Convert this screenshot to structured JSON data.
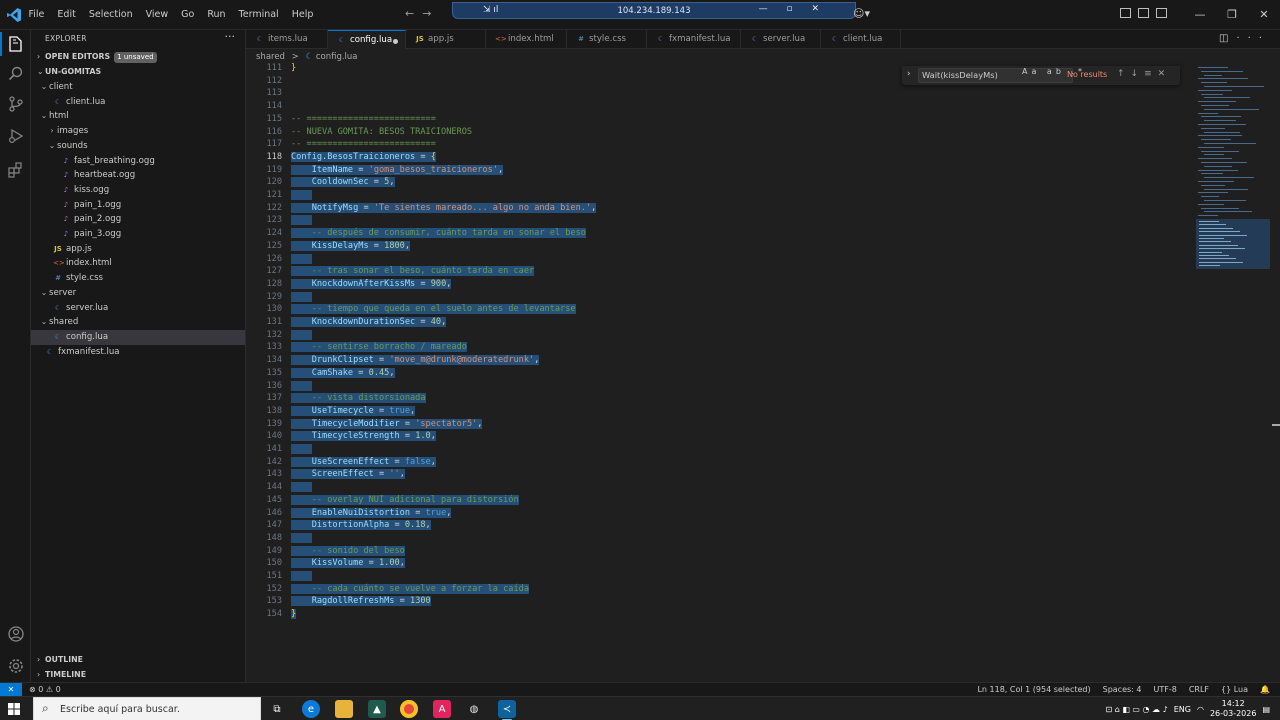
{
  "titlebar": {
    "menu": [
      "File",
      "Edit",
      "Selection",
      "View",
      "Go",
      "Run",
      "Terminal",
      "Help"
    ],
    "remote_ip": "104.234.189.143"
  },
  "sidebar": {
    "title": "EXPLORER",
    "open_editors_label": "OPEN EDITORS",
    "unsaved_badge": "1 unsaved",
    "project_label": "UN-GOMITAS",
    "tree": [
      {
        "label": "client",
        "type": "folder",
        "open": true,
        "depth": 1
      },
      {
        "label": "client.lua",
        "type": "lua",
        "depth": 2
      },
      {
        "label": "html",
        "type": "folder",
        "open": true,
        "depth": 1
      },
      {
        "label": "images",
        "type": "folder",
        "open": false,
        "depth": 2
      },
      {
        "label": "sounds",
        "type": "folder",
        "open": true,
        "depth": 2
      },
      {
        "label": "fast_breathing.ogg",
        "type": "ogg",
        "depth": 3
      },
      {
        "label": "heartbeat.ogg",
        "type": "ogg",
        "depth": 3
      },
      {
        "label": "kiss.ogg",
        "type": "ogg",
        "depth": 3
      },
      {
        "label": "pain_1.ogg",
        "type": "ogg",
        "depth": 3
      },
      {
        "label": "pain_2.ogg",
        "type": "ogg",
        "depth": 3
      },
      {
        "label": "pain_3.ogg",
        "type": "ogg",
        "depth": 3
      },
      {
        "label": "app.js",
        "type": "js",
        "depth": 2
      },
      {
        "label": "index.html",
        "type": "html",
        "depth": 2
      },
      {
        "label": "style.css",
        "type": "css",
        "depth": 2
      },
      {
        "label": "server",
        "type": "folder",
        "open": true,
        "depth": 1
      },
      {
        "label": "server.lua",
        "type": "lua",
        "depth": 2
      },
      {
        "label": "shared",
        "type": "folder",
        "open": true,
        "depth": 1
      },
      {
        "label": "config.lua",
        "type": "lua",
        "depth": 2,
        "selected": true
      },
      {
        "label": "fxmanifest.lua",
        "type": "lua",
        "depth": 1
      }
    ],
    "outline_label": "OUTLINE",
    "timeline_label": "TIMELINE"
  },
  "tabs": [
    {
      "label": "items.lua",
      "type": "lua"
    },
    {
      "label": "config.lua",
      "type": "lua",
      "active": true,
      "dirty": true
    },
    {
      "label": "app.js",
      "type": "js"
    },
    {
      "label": "index.html",
      "type": "html"
    },
    {
      "label": "style.css",
      "type": "css"
    },
    {
      "label": "fxmanifest.lua",
      "type": "lua"
    },
    {
      "label": "server.lua",
      "type": "lua"
    },
    {
      "label": "client.lua",
      "type": "lua"
    }
  ],
  "breadcrumb": {
    "folder": "shared",
    "sep": ">",
    "file": "config.lua"
  },
  "find": {
    "query": "Wait(kissDelayMs)",
    "options": "Aa ab .*",
    "result": "No results"
  },
  "editor": {
    "current_line": 118,
    "lines": [
      {
        "n": 111,
        "tokens": [
          [
            "}",
            "br"
          ]
        ]
      },
      {
        "n": 112,
        "tokens": []
      },
      {
        "n": 113,
        "tokens": []
      },
      {
        "n": 114,
        "tokens": []
      },
      {
        "n": 115,
        "tokens": [
          [
            "-- =========================",
            "cm"
          ]
        ]
      },
      {
        "n": 116,
        "tokens": [
          [
            "-- NUEVA GOMITA: BESOS TRAICIONEROS",
            "cm"
          ]
        ]
      },
      {
        "n": 117,
        "tokens": [
          [
            "-- =========================",
            "cm"
          ]
        ]
      },
      {
        "n": 118,
        "sel": true,
        "tokens": [
          [
            "Config",
            "id"
          ],
          [
            ".",
            "op"
          ],
          [
            "BesosTraicioneros",
            "id"
          ],
          [
            " = ",
            "op"
          ],
          [
            "{",
            "br"
          ]
        ]
      },
      {
        "n": 119,
        "sel": true,
        "tokens": [
          [
            "    ",
            ""
          ],
          [
            "ItemName",
            "id"
          ],
          [
            " = ",
            "op"
          ],
          [
            "'goma_besos_traicioneros'",
            "str"
          ],
          [
            ",",
            "op"
          ]
        ]
      },
      {
        "n": 120,
        "sel": true,
        "tokens": [
          [
            "    ",
            ""
          ],
          [
            "CooldownSec",
            "id"
          ],
          [
            " = ",
            "op"
          ],
          [
            "5",
            "num"
          ],
          [
            ",",
            "op"
          ]
        ]
      },
      {
        "n": 121,
        "sel": true,
        "tokens": [
          [
            "    ",
            ""
          ]
        ]
      },
      {
        "n": 122,
        "sel": true,
        "tokens": [
          [
            "    ",
            ""
          ],
          [
            "NotifyMsg",
            "id"
          ],
          [
            " = ",
            "op"
          ],
          [
            "'Te sientes mareado... algo no anda bien.'",
            "str"
          ],
          [
            ",",
            "op"
          ]
        ]
      },
      {
        "n": 123,
        "sel": true,
        "tokens": [
          [
            "    ",
            ""
          ]
        ]
      },
      {
        "n": 124,
        "sel": true,
        "tokens": [
          [
            "    ",
            ""
          ],
          [
            "-- después de consumir, cuánto tarda en sonar el beso",
            "cm"
          ]
        ]
      },
      {
        "n": 125,
        "sel": true,
        "tokens": [
          [
            "    ",
            ""
          ],
          [
            "KissDelayMs",
            "id"
          ],
          [
            " = ",
            "op"
          ],
          [
            "1800",
            "num"
          ],
          [
            ",",
            "op"
          ]
        ]
      },
      {
        "n": 126,
        "sel": true,
        "tokens": [
          [
            "    ",
            ""
          ]
        ]
      },
      {
        "n": 127,
        "sel": true,
        "tokens": [
          [
            "    ",
            ""
          ],
          [
            "-- tras sonar el beso, cuánto tarda en caer",
            "cm"
          ]
        ]
      },
      {
        "n": 128,
        "sel": true,
        "tokens": [
          [
            "    ",
            ""
          ],
          [
            "KnockdownAfterKissMs",
            "id"
          ],
          [
            " = ",
            "op"
          ],
          [
            "900",
            "num"
          ],
          [
            ",",
            "op"
          ]
        ]
      },
      {
        "n": 129,
        "sel": true,
        "tokens": [
          [
            "    ",
            ""
          ]
        ]
      },
      {
        "n": 130,
        "sel": true,
        "tokens": [
          [
            "    ",
            ""
          ],
          [
            "-- tiempo que queda en el suelo antes de levantarse",
            "cm"
          ]
        ]
      },
      {
        "n": 131,
        "sel": true,
        "tokens": [
          [
            "    ",
            ""
          ],
          [
            "KnockdownDurationSec",
            "id"
          ],
          [
            " = ",
            "op"
          ],
          [
            "40",
            "num"
          ],
          [
            ",",
            "op"
          ]
        ]
      },
      {
        "n": 132,
        "sel": true,
        "tokens": [
          [
            "    ",
            ""
          ]
        ]
      },
      {
        "n": 133,
        "sel": true,
        "tokens": [
          [
            "    ",
            ""
          ],
          [
            "-- sentirse borracho / mareado",
            "cm"
          ]
        ]
      },
      {
        "n": 134,
        "sel": true,
        "tokens": [
          [
            "    ",
            ""
          ],
          [
            "DrunkClipset",
            "id"
          ],
          [
            " = ",
            "op"
          ],
          [
            "'move_m@drunk@moderatedrunk'",
            "str"
          ],
          [
            ",",
            "op"
          ]
        ]
      },
      {
        "n": 135,
        "sel": true,
        "tokens": [
          [
            "    ",
            ""
          ],
          [
            "CamShake",
            "id"
          ],
          [
            " = ",
            "op"
          ],
          [
            "0.45",
            "num"
          ],
          [
            ",",
            "op"
          ]
        ]
      },
      {
        "n": 136,
        "sel": true,
        "tokens": [
          [
            "    ",
            ""
          ]
        ]
      },
      {
        "n": 137,
        "sel": true,
        "tokens": [
          [
            "    ",
            ""
          ],
          [
            "-- vista distorsionada",
            "cm"
          ]
        ]
      },
      {
        "n": 138,
        "sel": true,
        "tokens": [
          [
            "    ",
            ""
          ],
          [
            "UseTimecycle",
            "id"
          ],
          [
            " = ",
            "op"
          ],
          [
            "true",
            "kw"
          ],
          [
            ",",
            "op"
          ]
        ]
      },
      {
        "n": 139,
        "sel": true,
        "tokens": [
          [
            "    ",
            ""
          ],
          [
            "TimecycleModifier",
            "id"
          ],
          [
            " = ",
            "op"
          ],
          [
            "'spectator5'",
            "str"
          ],
          [
            ",",
            "op"
          ]
        ]
      },
      {
        "n": 140,
        "sel": true,
        "tokens": [
          [
            "    ",
            ""
          ],
          [
            "TimecycleStrength",
            "id"
          ],
          [
            " = ",
            "op"
          ],
          [
            "1.0",
            "num"
          ],
          [
            ",",
            "op"
          ]
        ]
      },
      {
        "n": 141,
        "sel": true,
        "tokens": [
          [
            "    ",
            ""
          ]
        ]
      },
      {
        "n": 142,
        "sel": true,
        "tokens": [
          [
            "    ",
            ""
          ],
          [
            "UseScreenEffect",
            "id"
          ],
          [
            " = ",
            "op"
          ],
          [
            "false",
            "kw"
          ],
          [
            ",",
            "op"
          ]
        ]
      },
      {
        "n": 143,
        "sel": true,
        "tokens": [
          [
            "    ",
            ""
          ],
          [
            "ScreenEffect",
            "id"
          ],
          [
            " = ",
            "op"
          ],
          [
            "''",
            "str"
          ],
          [
            ",",
            "op"
          ]
        ]
      },
      {
        "n": 144,
        "sel": true,
        "tokens": [
          [
            "    ",
            ""
          ]
        ]
      },
      {
        "n": 145,
        "sel": true,
        "tokens": [
          [
            "    ",
            ""
          ],
          [
            "-- overlay NUI adicional para distorsión",
            "cm"
          ]
        ]
      },
      {
        "n": 146,
        "sel": true,
        "tokens": [
          [
            "    ",
            ""
          ],
          [
            "EnableNuiDistortion",
            "id"
          ],
          [
            " = ",
            "op"
          ],
          [
            "true",
            "kw"
          ],
          [
            ",",
            "op"
          ]
        ]
      },
      {
        "n": 147,
        "sel": true,
        "tokens": [
          [
            "    ",
            ""
          ],
          [
            "DistortionAlpha",
            "id"
          ],
          [
            " = ",
            "op"
          ],
          [
            "0.18",
            "num"
          ],
          [
            ",",
            "op"
          ]
        ]
      },
      {
        "n": 148,
        "sel": true,
        "tokens": [
          [
            "    ",
            ""
          ]
        ]
      },
      {
        "n": 149,
        "sel": true,
        "tokens": [
          [
            "    ",
            ""
          ],
          [
            "-- sonido del beso",
            "cm"
          ]
        ]
      },
      {
        "n": 150,
        "sel": true,
        "tokens": [
          [
            "    ",
            ""
          ],
          [
            "KissVolume",
            "id"
          ],
          [
            " = ",
            "op"
          ],
          [
            "1.00",
            "num"
          ],
          [
            ",",
            "op"
          ]
        ]
      },
      {
        "n": 151,
        "sel": true,
        "tokens": [
          [
            "    ",
            ""
          ]
        ]
      },
      {
        "n": 152,
        "sel": true,
        "tokens": [
          [
            "    ",
            ""
          ],
          [
            "-- cada cuánto se vuelve a forzar la caída",
            "cm"
          ]
        ]
      },
      {
        "n": 153,
        "sel": true,
        "tokens": [
          [
            "    ",
            ""
          ],
          [
            "RagdollRefreshMs",
            "id"
          ],
          [
            " = ",
            "op"
          ],
          [
            "1300",
            "num"
          ]
        ]
      },
      {
        "n": 154,
        "sel": true,
        "tokens": [
          [
            "}",
            "br"
          ]
        ]
      }
    ]
  },
  "statusbar": {
    "errors": "⊗ 0 ⚠ 0",
    "position": "Ln 118, Col 1 (954 selected)",
    "spaces": "Spaces: 4",
    "encoding": "UTF-8",
    "eol": "CRLF",
    "language": "{} Lua"
  },
  "taskbar": {
    "search_placeholder": "Escribe aquí para buscar.",
    "lang": "ENG",
    "time": "14:12",
    "date": "26-03-2026"
  },
  "colors": {
    "accent": "#0078d4",
    "selection": "#264f78",
    "comment": "#6a9955",
    "string": "#ce9178"
  }
}
